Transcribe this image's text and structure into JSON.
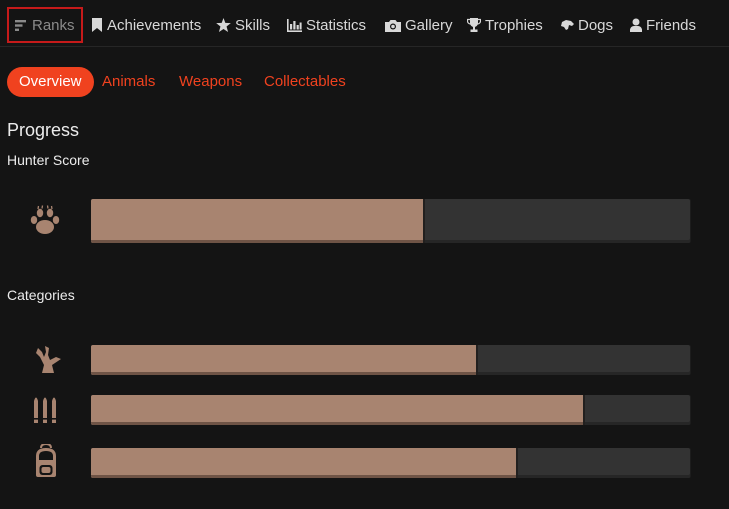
{
  "nav": {
    "items": [
      {
        "label": "Ranks",
        "icon": "ranks-icon"
      },
      {
        "label": "Achievements",
        "icon": "bookmark-icon"
      },
      {
        "label": "Skills",
        "icon": "star-icon"
      },
      {
        "label": "Statistics",
        "icon": "bar-chart-icon"
      },
      {
        "label": "Gallery",
        "icon": "camera-icon"
      },
      {
        "label": "Trophies",
        "icon": "trophy-icon"
      },
      {
        "label": "Dogs",
        "icon": "dog-icon"
      },
      {
        "label": "Friends",
        "icon": "user-icon"
      }
    ],
    "active_index": 0
  },
  "subtabs": {
    "items": [
      {
        "label": "Overview"
      },
      {
        "label": "Animals"
      },
      {
        "label": "Weapons"
      },
      {
        "label": "Collectables"
      }
    ],
    "active_index": 0
  },
  "progress": {
    "title": "Progress",
    "hunter_score": {
      "label": "Hunter Score",
      "icon": "paw-icon",
      "fraction": 0.555
    },
    "categories": {
      "label": "Categories",
      "items": [
        {
          "icon": "antler-icon",
          "fraction": 0.643
        },
        {
          "icon": "ammo-icon",
          "fraction": 0.822
        },
        {
          "icon": "backpack-icon",
          "fraction": 0.71
        }
      ]
    }
  },
  "colors": {
    "accent": "#f0421f",
    "bar_fill": "#a88470",
    "bar_track": "#333333",
    "icon": "#a88470",
    "active_border": "#c61a1a"
  }
}
